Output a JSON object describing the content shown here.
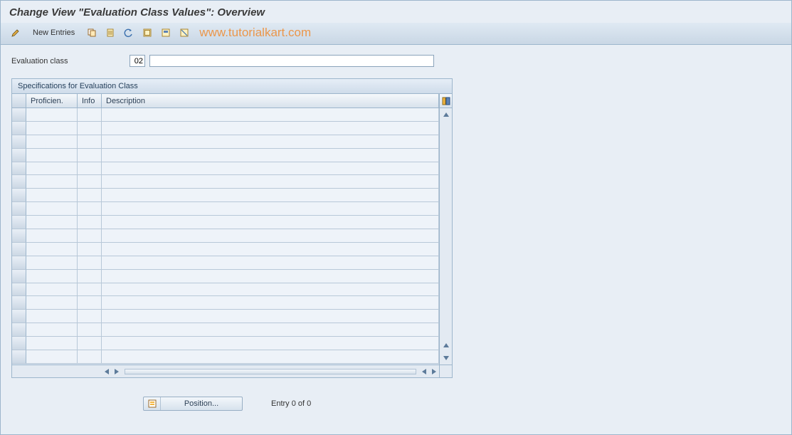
{
  "header": {
    "title": "Change View \"Evaluation Class Values\": Overview"
  },
  "toolbar": {
    "new_entries": "New Entries"
  },
  "watermark": "www.tutorialkart.com",
  "fields": {
    "evaluation_class_label": "Evaluation class",
    "evaluation_class_value": "02",
    "evaluation_class_desc": ""
  },
  "panel": {
    "title": "Specifications for Evaluation Class",
    "columns": {
      "proficien": "Proficien.",
      "info": "Info",
      "description": "Description"
    }
  },
  "table": {
    "row_count": 19
  },
  "footer": {
    "position_label": "Position...",
    "entry_text": "Entry 0 of 0"
  }
}
